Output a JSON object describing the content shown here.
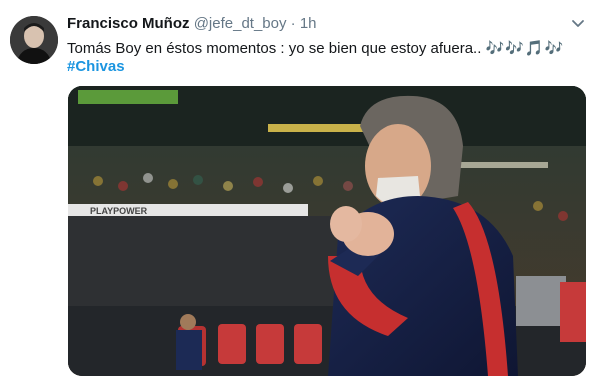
{
  "tweet": {
    "author_name": "Francisco Muñoz",
    "handle": "@jefe_dt_boy",
    "separator": "·",
    "time": "1h",
    "text": "Tomás Boy en éstos momentos : yo se bien que estoy afuera..",
    "emoji": "🎶🎶🎵🎶",
    "hashtag": "#Chivas",
    "media_ad_text": "PLAYPOWER"
  },
  "icons": {
    "menu": "chevron-down-icon"
  },
  "colors": {
    "link": "#1b95e0",
    "muted": "#657786",
    "text": "#14171a"
  }
}
